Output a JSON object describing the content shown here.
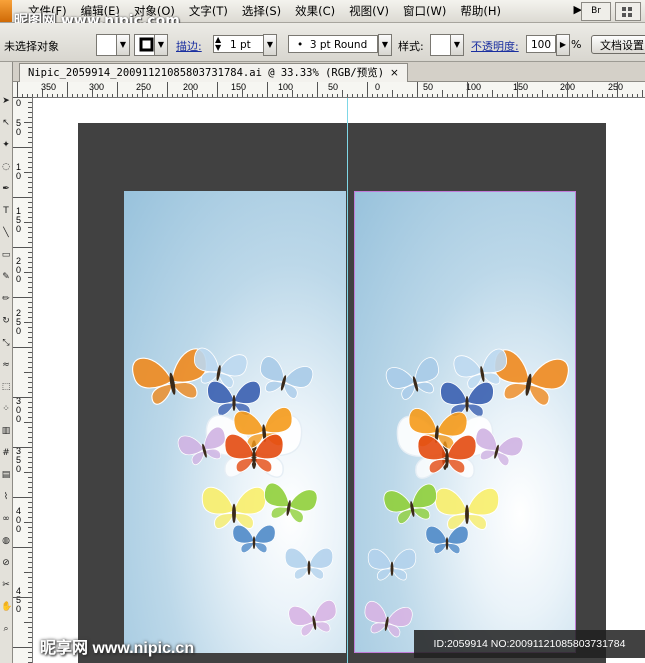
{
  "menubar": {
    "watermark": "昵图网 www.nipic.com",
    "items": [
      "文件(F)",
      "编辑(E)",
      "对象(O)",
      "文字(T)",
      "选择(S)",
      "效果(C)",
      "视图(V)",
      "窗口(W)",
      "帮助(H)"
    ],
    "bridge_label": "Br"
  },
  "controlbar": {
    "selection_status": "未选择对象",
    "stroke_label": "描边:",
    "stroke_weight": "1 pt",
    "brush": "3 pt Round",
    "style_label": "样式:",
    "opacity_label": "不透明度:",
    "opacity_value": "100",
    "opacity_unit": "%",
    "doc_settings_button": "文档设置"
  },
  "document": {
    "tab_title": "Nipic_2059914_20091121085803731784.ai @ 33.33% (RGB/预览)",
    "close_glyph": "×"
  },
  "hruler": {
    "labels": [
      "350",
      "300",
      "250",
      "200",
      "150",
      "100",
      "50",
      "0",
      "50",
      "100",
      "150",
      "200",
      "250"
    ]
  },
  "vruler": {
    "labels": [
      "0",
      "5",
      "0",
      "1",
      "0",
      "1",
      "5",
      "0",
      "2",
      "0",
      "0",
      "2",
      "5",
      "0",
      "3",
      "0",
      "0",
      "3",
      "5",
      "0",
      "4",
      "0",
      "0",
      "4",
      "5",
      "0"
    ]
  },
  "watermarks": {
    "bottom": "昵享网 www.nipic.cn",
    "id_line": "ID:2059914 NO:20091121085803731784"
  },
  "colors": {
    "bleed": "#414141",
    "panel_light": "#eaf3f9",
    "panel_dark": "#98c2dc",
    "artboard_border": "#c07cd8",
    "guide": "#7fd7e6"
  }
}
